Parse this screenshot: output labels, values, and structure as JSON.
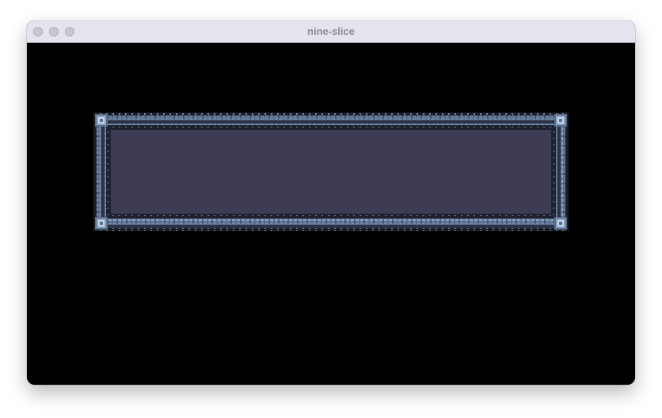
{
  "window": {
    "title": "nine-slice"
  },
  "icons": {
    "close": "traffic-light-close",
    "minimize": "traffic-light-minimize",
    "zoom": "traffic-light-zoom"
  },
  "colors": {
    "canvas_background": "#000000",
    "panel_fill": "#3e3b54",
    "frame_base": "#5b6f8c",
    "frame_highlight": "#8aa4c2",
    "frame_dark": "#2c3247",
    "titlebar_background": "#e6e3ef",
    "title_text": "#8f8c96"
  }
}
